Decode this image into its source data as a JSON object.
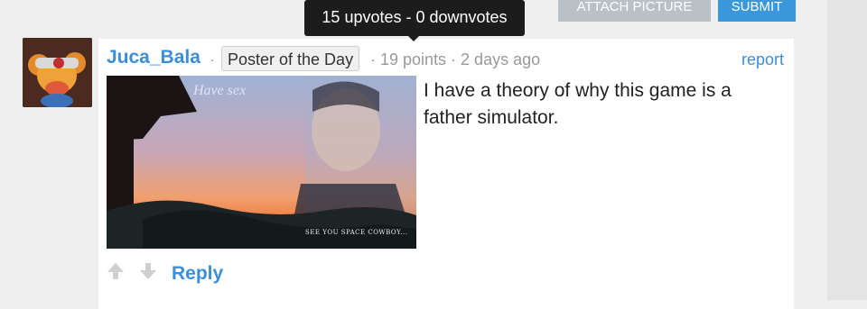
{
  "toolbar": {
    "attach_label": "ATTACH PICTURE",
    "submit_label": "SUBMIT"
  },
  "tooltip": {
    "text": "15 upvotes - 0 downvotes"
  },
  "comment": {
    "username": "Juca_Bala",
    "separator": "·",
    "badge": "Poster of the Day",
    "meta": "· 19 points · 2 days ago",
    "report_label": "report",
    "text": "I have a theory of why this game is a father simulator.",
    "image": {
      "overlay_text": "Have sex",
      "caption": "SEE YOU SPACE COWBOY..."
    },
    "reply_label": "Reply"
  },
  "colors": {
    "link": "#3c8ed8",
    "submit": "#3a98da",
    "attach": "#b9c0c6",
    "tooltip_bg": "#1c1c1c"
  },
  "icons": {
    "upvote": "arrow-up-icon",
    "downvote": "arrow-down-icon"
  }
}
